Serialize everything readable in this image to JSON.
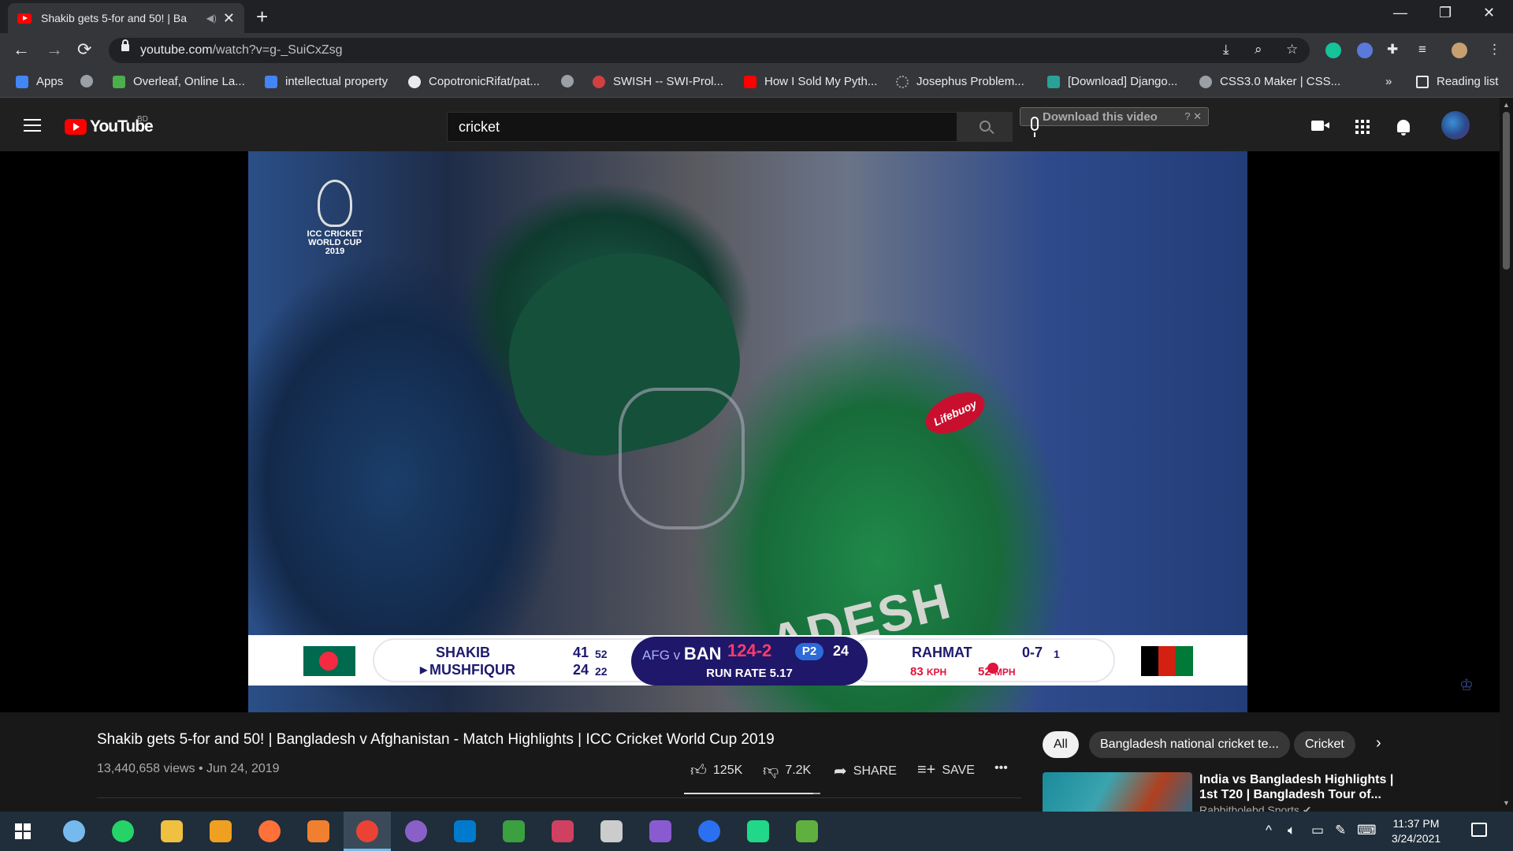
{
  "browser": {
    "tab_title": "Shakib gets 5-for and 50! | Ba",
    "tab_audio": "◀)",
    "url_host": "youtube.com",
    "url_path": "/watch?v=g-_SuiCxZsg",
    "window_controls": [
      "—",
      "❐",
      "✕"
    ],
    "new_tab": "+",
    "nav": [
      "←",
      "→",
      "⟳"
    ]
  },
  "bookmarks": [
    {
      "label": "Apps",
      "icon": "apps-grid-icon",
      "color": "#4285f4"
    },
    {
      "label": "",
      "icon": "globe-icon",
      "color": "#9aa0a6"
    },
    {
      "label": "Overleaf, Online La...",
      "icon": "overleaf-leaf-icon",
      "color": "#4cae4c"
    },
    {
      "label": "intellectual property",
      "icon": "scholar-icon",
      "color": "#4285f4"
    },
    {
      "label": "CopotronicRifat/pat...",
      "icon": "github-icon",
      "color": "#e8eaed"
    },
    {
      "label": "",
      "icon": "globe-icon",
      "color": "#9aa0a6"
    },
    {
      "label": "SWISH -- SWI-Prol...",
      "icon": "swish-owl-icon",
      "color": "#d04040"
    },
    {
      "label": "How I Sold My Pyth...",
      "icon": "youtube-icon",
      "color": "#ff0000"
    },
    {
      "label": "Josephus Problem...",
      "icon": "loading-icon",
      "color": "#9aa0a6"
    },
    {
      "label": "[Download] Django...",
      "icon": "image-icon",
      "color": "#2aa198"
    },
    {
      "label": "CSS3.0 Maker | CSS...",
      "icon": "globe-icon",
      "color": "#9aa0a6"
    }
  ],
  "bookmarks_overflow": "»",
  "reading_list": "Reading list",
  "youtube": {
    "logo_text": "YouTube",
    "country": "BD",
    "search_value": "cricket",
    "download_label": "Download this video",
    "download_extra": "? ✕"
  },
  "video": {
    "overlay_logo_text": "ICC CRICKET WORLD CUP 2019",
    "jersey_text": "ADESH",
    "sponsor": "Lifebuoy",
    "scorebar": {
      "batter1_name": "SHAKIB",
      "batter1_runs": "41",
      "batter1_balls": "52",
      "batter2_name": "MUSHFIQUR",
      "batter2_runs": "24",
      "batter2_balls": "22",
      "teams_prefix": "AFG v",
      "batting_team": "BAN",
      "score": "124-2",
      "powerplay": "P2",
      "overs": "24",
      "run_rate": "RUN RATE 5.17",
      "bowler_name": "RAHMAT",
      "bowler_figures": "0-7",
      "bowler_overs": "1",
      "speed_kph": "83",
      "kph_unit": "KPH",
      "speed_mph": "52",
      "mph_unit": "MPH"
    }
  },
  "video_info": {
    "title": "Shakib gets 5-for and 50! | Bangladesh v Afghanistan - Match Highlights | ICC Cricket World Cup 2019",
    "views": "13,440,658 views",
    "date": "Jun 24, 2019",
    "likes": "125K",
    "dislikes": "7.2K",
    "share": "SHARE",
    "save": "SAVE",
    "more": "•••",
    "like_ratio": 0.946
  },
  "chips": [
    "All",
    "Bangladesh national cricket te...",
    "Cricket"
  ],
  "recommendation": {
    "title": "India vs Bangladesh Highlights | 1st T20 | Bangladesh Tour of...",
    "channel": "Rabbitholebd Sports ✔"
  },
  "taskbar": {
    "apps": [
      {
        "icon": "windows-start-icon"
      },
      {
        "icon": "cortana-icon",
        "color": "#76b9ed"
      },
      {
        "icon": "whatsapp-icon",
        "color": "#25d366"
      },
      {
        "icon": "file-explorer-icon",
        "color": "#f0c040"
      },
      {
        "icon": "brave-like-icon",
        "color": "#f0a020"
      },
      {
        "icon": "firefox-icon",
        "color": "#ff7139"
      },
      {
        "icon": "photo-app-icon",
        "color": "#f08030"
      },
      {
        "icon": "chrome-icon",
        "color": "#ea4335"
      },
      {
        "icon": "github-desktop-icon",
        "color": "#8a60c8"
      },
      {
        "icon": "vscode-icon",
        "color": "#007acc"
      },
      {
        "icon": "globe-app-icon",
        "color": "#3aa040"
      },
      {
        "icon": "paint-icon",
        "color": "#d04060"
      },
      {
        "icon": "inkscape-icon",
        "color": "#cccccc"
      },
      {
        "icon": "visual-studio-icon",
        "color": "#8a5ad0"
      },
      {
        "icon": "messenger-icon",
        "color": "#2a70f0"
      },
      {
        "icon": "pycharm-icon",
        "color": "#21d789"
      },
      {
        "icon": "notepad-icon",
        "color": "#60b040"
      }
    ],
    "time": "11:37 PM",
    "date": "3/24/2021"
  }
}
